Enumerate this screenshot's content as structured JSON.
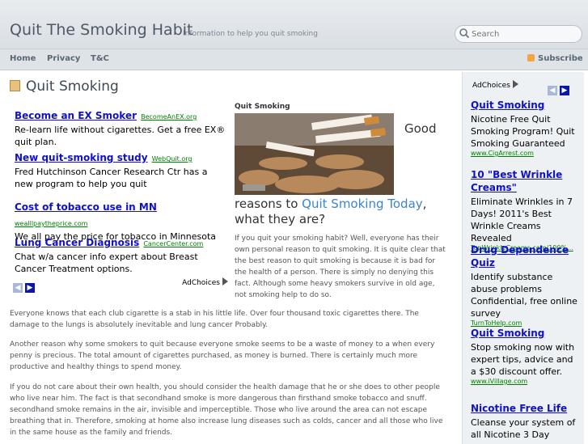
{
  "header": {
    "site_title": "Quit The Smoking Habit",
    "tagline": "Information to help you quit smoking",
    "search_placeholder": "Search"
  },
  "nav": {
    "items": [
      "Home",
      "Privacy",
      "T&C"
    ],
    "subscribe": "Subscribe"
  },
  "post": {
    "title": "Quit Smoking",
    "image_caption": "Quit Smoking",
    "headline_word": "Good",
    "headline_pre": "reasons to ",
    "headline_link": "Quit Smoking Today",
    "headline_post": ", what they are?",
    "intro": "If you quit your smoking habit? Well, everyone has their own personal reason to quit smoking. It is quite clear that the best reason to quit smoking is because it is bad for the health of a person. There is simply no denying this fact. Although some heavy smokers survive in old age, not smoking help to do so.",
    "paragraphs": [
      "Everyone knows that each club cigarette is a stab in his little life. Over four thousand toxic cigarettes there. The damage to the lungs is absolutely inevitable and lung cancer Probably.",
      "Another reason why some smokers to quit because everyone smoke seems to be a waste of money to a when every penny is precious. The total amount of cigarettes purchased, as money is burned. There is certainly much more productive and healthy things to spend money.",
      "If you do not care about their own health, you should consider the health damage that he or she does to other people who live near him. The fact is that secondhand smoke is more dangerous than firsthand smoke tobacco and snuff. secondhand smoke remains in the air, invisible and imperceptible. Those who live around the area can not escape breathing that in. Therefore, smoking at home also increase lung diseases such as colds, cancer and all those who live in the same house as the family and friends."
    ]
  },
  "left_ads": {
    "items": [
      {
        "title": "Become an EX Smoker",
        "url": "BecomeAnEX.org",
        "desc": "Re-learn life without cigarettes. Get a free EX® quit plan."
      },
      {
        "title": "New quit-smoking study",
        "url": "WebQuit.org",
        "desc": "Fred Hutchinson Cancer Research Ctr has a new program to help you quit"
      },
      {
        "title": "Cost of tobacco use in MN",
        "url": "wealllpaytheprice.com",
        "desc": "We all pay the price for tobacco in Minnesota"
      },
      {
        "title": "Lung Cancer Diagnosis",
        "url": "CancerCenter.com",
        "desc": "Chat w/a cancer info expert about Breast Cancer Treatment options."
      }
    ],
    "adchoices": "AdChoices"
  },
  "sidebar_ads": {
    "adchoices": "AdChoices",
    "items": [
      {
        "title": "Quit Smoking",
        "desc": "Nicotine Free Quit Smoking Program! Quit Smoking Guaranteed",
        "url": "www.CigArrest.com"
      },
      {
        "title": "10 \"Best Wrinkle Creams\"",
        "desc": "Eliminate Wrinkles in 7 Days! 2011's Best Wrinkle Creams Revealed",
        "url": "TopWrinkleCreams.com/100%..."
      },
      {
        "title": "Drug Dependence Quiz",
        "desc": "Identify substance abuse problems Confidential, free online survey",
        "url": "TurnToHelp.com"
      },
      {
        "title": "Quit Smoking",
        "desc": "Stop smoking now with expert tips, advice and a $30 discount offer.",
        "url": "www.iVillage.com"
      },
      {
        "title": "Nicotine Free Life",
        "desc": "Cleanse your system of all Nicotine 3 Day",
        "url": ""
      }
    ]
  },
  "colors": {
    "ad_link": "#1111cc",
    "ad_url": "#008000",
    "headline_link": "#3a86c8",
    "header_bg": "#dadfe4",
    "sidebar_bg": "#eef1f3"
  }
}
